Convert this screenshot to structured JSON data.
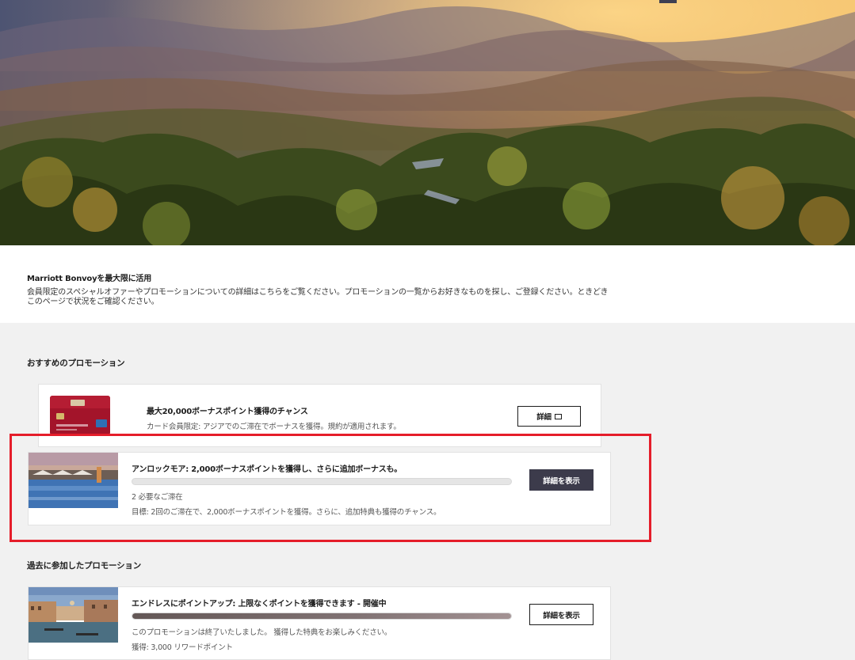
{
  "intro": {
    "title": "Marriott Bonvoyを最大限に活用",
    "description": "会員限定のスペシャルオファーやプロモーションについての詳細はこちらをご覧ください。プロモーションの一覧からお好きなものを探し、ご登録ください。ときどきこのページで状況をご確認ください。"
  },
  "recommended": {
    "heading": "おすすめのプロモーション",
    "card1": {
      "title": "最大20,000ボーナスポイント獲得のチャンス",
      "subtitle": "カード会員限定: アジアでのご滞在でボーナスを獲得。規約が適用されます。",
      "button_label": "詳細",
      "image_icon": "credit-card-image"
    },
    "card2": {
      "title": "アンロックモア: 2,000ボーナスポイントを獲得し、さらに追加ボーナスも。",
      "progress_fraction": 0.0,
      "stays_required": "2 必要なご滞在",
      "goal": "目標: 2回のご滞在で、2,000ボーナスポイントを獲得。さらに、追加特典も獲得のチャンス。",
      "button_label": "詳細を表示",
      "image_icon": "resort-pool-image"
    }
  },
  "past": {
    "heading": "過去に参加したプロモーション",
    "card1": {
      "title": "エンドレスにポイントアップ: 上限なくポイントを獲得できます - 開催中",
      "progress_fraction": 1.0,
      "status": "このプロモーションは終了いたしました。 獲得した特典をお楽しみください。",
      "earned": "獲得: 3,000 リワードポイント",
      "button_label": "詳細を表示",
      "image_icon": "venice-canal-image"
    }
  },
  "colors": {
    "accent_dark": "#3c3b4b",
    "highlight_red": "#e51d2a",
    "progress_fill": "#7a6c6c"
  }
}
